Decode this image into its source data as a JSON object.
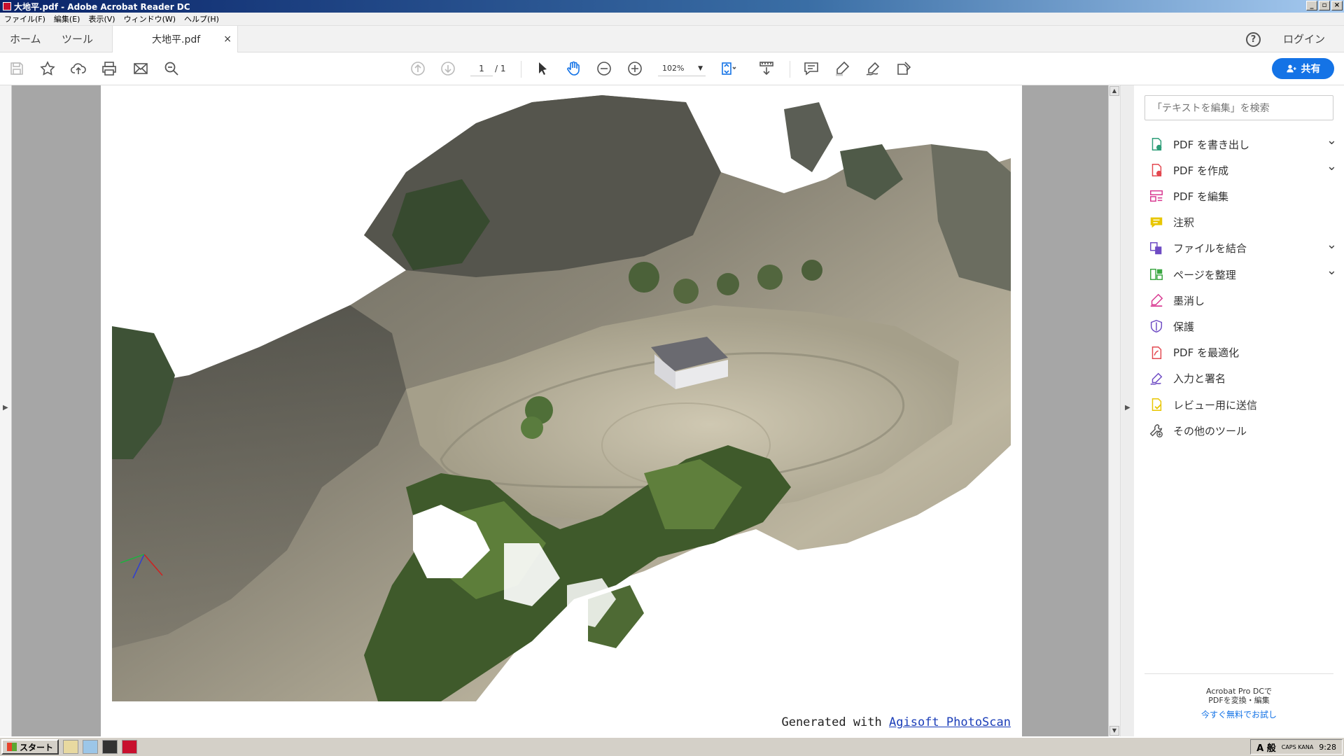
{
  "window": {
    "title": "大地平.pdf - Adobe Acrobat Reader DC",
    "minimize": "_",
    "maximize": "▫",
    "close": "×"
  },
  "menu": [
    "ファイル(F)",
    "編集(E)",
    "表示(V)",
    "ウィンドウ(W)",
    "ヘルプ(H)"
  ],
  "tabs": {
    "home": "ホーム",
    "tools": "ツール",
    "document": "大地平.pdf",
    "close_glyph": "×"
  },
  "header": {
    "help_glyph": "?",
    "login": "ログイン"
  },
  "toolbar": {
    "page_current": "1",
    "page_total": "/ 1",
    "zoom": "102%",
    "share_label": "共有"
  },
  "document": {
    "footer_prefix": "Generated with ",
    "footer_link": "Agisoft PhotoScan"
  },
  "tools_pane": {
    "search_placeholder": "「テキストを編集」を検索",
    "items": [
      {
        "label": "PDF を書き出し",
        "expandable": true,
        "icon": "export-pdf-icon",
        "color": "#2d9d78"
      },
      {
        "label": "PDF を作成",
        "expandable": true,
        "icon": "create-pdf-icon",
        "color": "#e34850"
      },
      {
        "label": "PDF を編集",
        "expandable": false,
        "icon": "edit-pdf-icon",
        "color": "#d83790"
      },
      {
        "label": "注釈",
        "expandable": false,
        "icon": "comment-icon",
        "color": "#e8c600"
      },
      {
        "label": "ファイルを結合",
        "expandable": true,
        "icon": "combine-files-icon",
        "color": "#6e4bc4"
      },
      {
        "label": "ページを整理",
        "expandable": true,
        "icon": "organize-pages-icon",
        "color": "#3aa641"
      },
      {
        "label": "墨消し",
        "expandable": false,
        "icon": "redact-icon",
        "color": "#d83790"
      },
      {
        "label": "保護",
        "expandable": false,
        "icon": "protect-icon",
        "color": "#6e4bc4"
      },
      {
        "label": "PDF を最適化",
        "expandable": false,
        "icon": "optimize-pdf-icon",
        "color": "#e34850"
      },
      {
        "label": "入力と署名",
        "expandable": false,
        "icon": "fill-sign-icon",
        "color": "#6e4bc4"
      },
      {
        "label": "レビュー用に送信",
        "expandable": false,
        "icon": "send-review-icon",
        "color": "#e8c600"
      },
      {
        "label": "その他のツール",
        "expandable": false,
        "icon": "more-tools-icon",
        "color": "#555555"
      }
    ],
    "promo_line1": "Acrobat Pro DCで",
    "promo_line2": "PDFを変換・編集",
    "promo_link": "今すぐ無料でお試し"
  },
  "taskbar": {
    "start": "スタート",
    "ime": "A 般",
    "caps": "CAPS KANA",
    "clock": "9:28"
  },
  "colors": {
    "accent": "#1473e6",
    "doc_bg": "#a6a6a6"
  }
}
